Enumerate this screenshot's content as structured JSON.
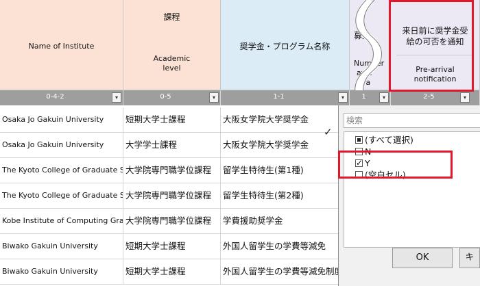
{
  "headers": {
    "institute": "Name of Institute",
    "course_jp": "課程",
    "course_en_1": "Academic",
    "course_en_2": "level",
    "scholarship_jp": "奨学金・プログラム名称",
    "recruit_jp": "募集",
    "recruit_en_1": "Number",
    "recruit_en_2": "awa",
    "recruit_en_3": "gra",
    "preArrival_jp_1": "来日前に奨学金受",
    "preArrival_jp_2": "給の可否を通知",
    "preArrival_en_1": "Pre-arrival",
    "preArrival_en_2": "notification"
  },
  "codes": {
    "institute": "0-4-2",
    "course": "0-5",
    "scholarship": "1-1",
    "recruit": "1",
    "preArrival": "2-5",
    "dropdown": "▾"
  },
  "rows": [
    {
      "institute": "Osaka Jo Gakuin University",
      "course": "短期大学士課程",
      "scholarship": "大阪女学院大学奨学金"
    },
    {
      "institute": "Osaka Jo Gakuin University",
      "course": "大学学士課程",
      "scholarship": "大阪女学院大学奨学金"
    },
    {
      "institute": "The Kyoto College of Graduate S",
      "course": "大学院専門職学位課程",
      "scholarship": "留学生特待生(第1種)"
    },
    {
      "institute": "The Kyoto College of Graduate S",
      "course": "大学院専門職学位課程",
      "scholarship": "留学生特待生(第2種)"
    },
    {
      "institute": "Kobe Institute of Computing Grad",
      "course": "大学院専門職学位課程",
      "scholarship": "学費援助奨学金"
    },
    {
      "institute": "Biwako Gakuin University",
      "course": "短期大学士課程",
      "scholarship": "外国人留学生の学費等減免"
    },
    {
      "institute": "Biwako Gakuin University",
      "course": "短期大学士課程",
      "scholarship": "外国人留学生の学費等減免制度"
    }
  ],
  "filter": {
    "search_placeholder": "検索",
    "items": [
      {
        "label": "(すべて選択)",
        "state": "partial"
      },
      {
        "label": "N",
        "state": "unchecked"
      },
      {
        "label": "Y",
        "state": "checked"
      },
      {
        "label": "(空白セル)",
        "state": "unchecked"
      }
    ],
    "ok_label": "OK",
    "cancel_label": "キ"
  },
  "colors": {
    "header_peach": "#fbe2d5",
    "header_blue": "#dcecf7",
    "header_lavender": "#ece8f4",
    "filter_bar": "#9e9e9e",
    "highlight_red": "#e2172a"
  }
}
